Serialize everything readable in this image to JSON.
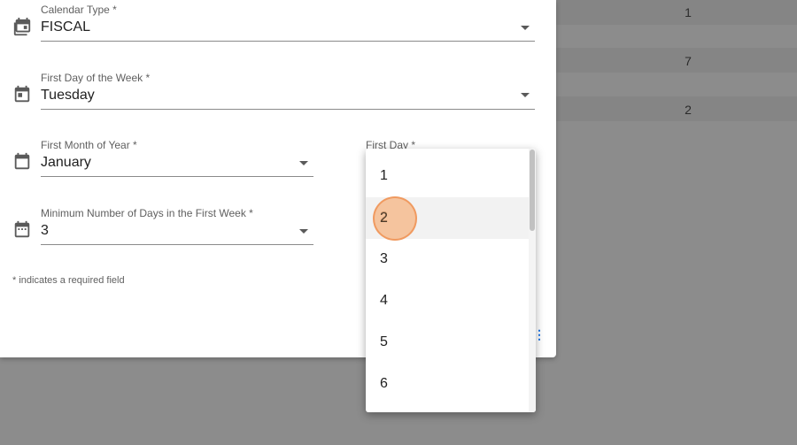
{
  "background_table": {
    "values": [
      "1",
      "7",
      "2"
    ]
  },
  "dialog": {
    "calendar_type": {
      "label": "Calendar Type *",
      "value": "FISCAL",
      "icon": "calendar-multiple-icon"
    },
    "first_day_of_week": {
      "label": "First Day of the Week *",
      "value": "Tuesday",
      "icon": "calendar-icon"
    },
    "first_month_of_year": {
      "label": "First Month of Year *",
      "value": "January",
      "icon": "calendar-blank-icon"
    },
    "first_day": {
      "label": "First Day *"
    },
    "min_days_first_week": {
      "label": "Minimum Number of Days in the First Week *",
      "value": "3",
      "icon": "calendar-dots-icon"
    },
    "required_note": "* indicates a required field"
  },
  "dropdown": {
    "options": [
      "1",
      "2",
      "3",
      "4",
      "5",
      "6"
    ],
    "hovered": "2"
  },
  "colors": {
    "overlay": "#8c8c8c",
    "accent": "#1a73e8",
    "click_marker": "#f6b482"
  }
}
